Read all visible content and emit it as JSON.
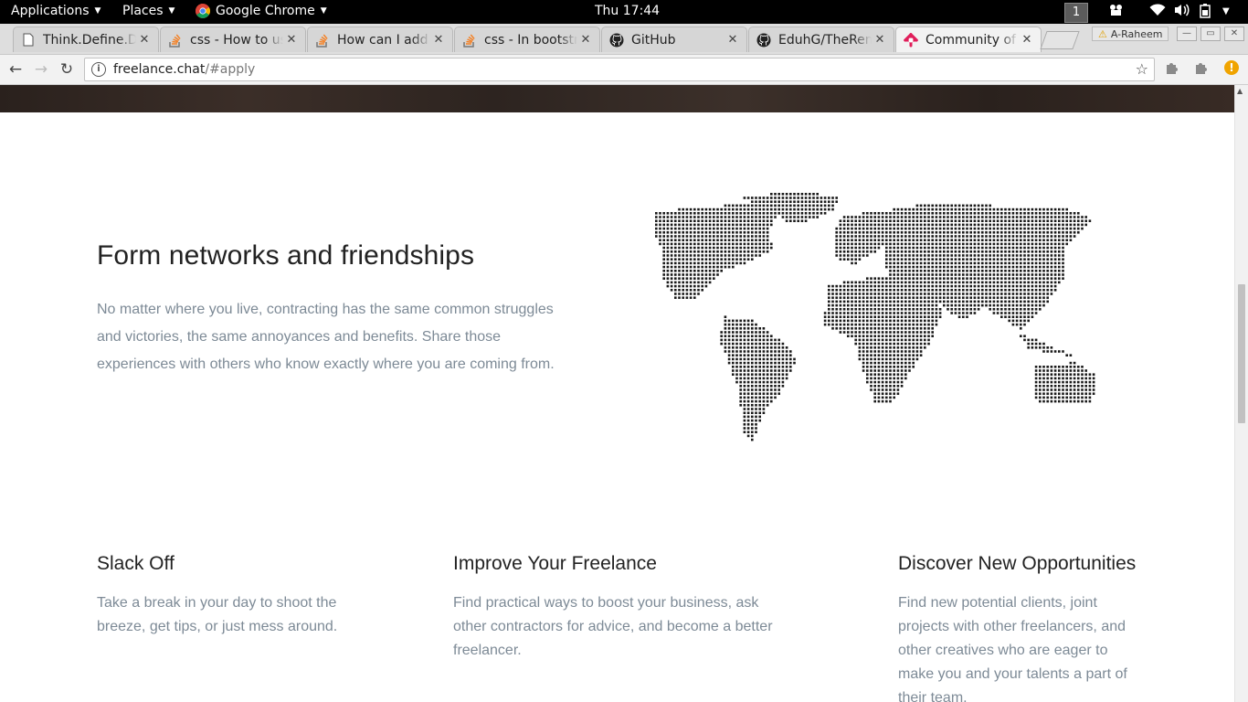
{
  "topbar": {
    "applications": "Applications",
    "places": "Places",
    "browser": "Google Chrome",
    "clock": "Thu 17:44",
    "workspace": "1"
  },
  "tabs": [
    {
      "label": "Think.Define.Do",
      "icon": "page-icon",
      "active": false
    },
    {
      "label": "css - How to use",
      "icon": "stackoverflow-icon",
      "active": false
    },
    {
      "label": "How can I add a",
      "icon": "stackoverflow-icon",
      "active": false
    },
    {
      "label": "css - In bootstrap",
      "icon": "stackoverflow-icon",
      "active": false
    },
    {
      "label": "GitHub",
      "icon": "github-icon",
      "active": false
    },
    {
      "label": "EduhG/TheRem",
      "icon": "github-icon",
      "active": false
    },
    {
      "label": "Community of fr",
      "icon": "slack-icon",
      "active": true
    }
  ],
  "profile": {
    "name": "A-Raheem"
  },
  "address": {
    "host": "freelance.chat",
    "path": "/#apply"
  },
  "colors": {
    "heading": "#222222",
    "body_text": "#7d8a96",
    "map_dot": "#1a1a1a",
    "alert": "#f0a400"
  },
  "main": {
    "title": "Form networks and friendships",
    "body": "No matter where you live, contracting has the same common struggles and victories, the same annoyances and benefits. Share those experiences with others who know exactly where you are coming from."
  },
  "features": [
    {
      "title": "Slack Off",
      "body": "Take a break in your day to shoot the breeze, get tips, or just mess around."
    },
    {
      "title": "Improve Your Freelance",
      "body": "Find practical ways to boost your business, ask other contractors for advice, and become a better freelancer."
    },
    {
      "title": "Discover New Opportunities",
      "body": "Find new potential clients, joint projects with other freelancers, and other creatives who are eager to make you and your talents a part of their team."
    }
  ]
}
